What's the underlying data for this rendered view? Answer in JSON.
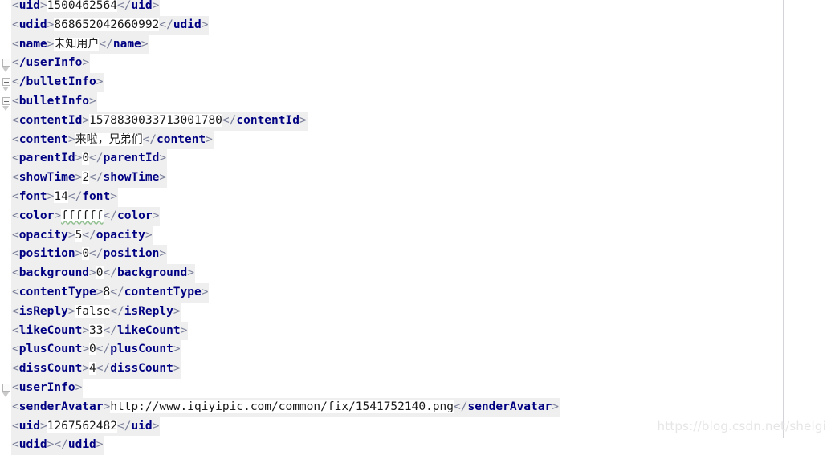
{
  "editor": {
    "type": "xml-source-view",
    "colors": {
      "tag_name": "#000082",
      "bracket": "#7a7f9a",
      "text_value": "#1a1a1a",
      "tag_highlight_bg": "#efefef",
      "background": "#ffffff",
      "fold_marker": "#b4b4b4",
      "margin_guide": "#d4d4d8",
      "spellcheck_underline": "#8fbf8f",
      "watermark": "#e6e6e6"
    },
    "margin_guide_column_x": 975
  },
  "watermark": {
    "text": "https://blog.csdn.net/shelgi"
  },
  "lines": [
    {
      "n": 1,
      "fold": "none",
      "tag": "uid",
      "value": "1500462564",
      "closing": false,
      "cjk": false,
      "typo": false
    },
    {
      "n": 2,
      "fold": "none",
      "tag": "udid",
      "value": "868652042660992",
      "closing": false,
      "cjk": false,
      "typo": false
    },
    {
      "n": 3,
      "fold": "none",
      "tag": "name",
      "value": "未知用户",
      "closing": false,
      "cjk": true,
      "typo": false
    },
    {
      "n": 4,
      "fold": "end",
      "tag": "/userInfo",
      "value": null,
      "closing": true,
      "cjk": false,
      "typo": false
    },
    {
      "n": 5,
      "fold": "end",
      "tag": "/bulletInfo",
      "value": null,
      "closing": true,
      "cjk": false,
      "typo": false
    },
    {
      "n": 6,
      "fold": "start",
      "tag": "bulletInfo",
      "value": null,
      "closing": false,
      "cjk": false,
      "typo": false
    },
    {
      "n": 7,
      "fold": "none",
      "tag": "contentId",
      "value": "1578830033713001780",
      "closing": false,
      "cjk": false,
      "typo": false
    },
    {
      "n": 8,
      "fold": "none",
      "tag": "content",
      "value": "来啦，兄弟们",
      "closing": false,
      "cjk": true,
      "typo": false
    },
    {
      "n": 9,
      "fold": "none",
      "tag": "parentId",
      "value": "0",
      "closing": false,
      "cjk": false,
      "typo": false
    },
    {
      "n": 10,
      "fold": "none",
      "tag": "showTime",
      "value": "2",
      "closing": false,
      "cjk": false,
      "typo": false
    },
    {
      "n": 11,
      "fold": "none",
      "tag": "font",
      "value": "14",
      "closing": false,
      "cjk": false,
      "typo": false
    },
    {
      "n": 12,
      "fold": "none",
      "tag": "color",
      "value": "ffffff",
      "closing": false,
      "cjk": false,
      "typo": true
    },
    {
      "n": 13,
      "fold": "none",
      "tag": "opacity",
      "value": "5",
      "closing": false,
      "cjk": false,
      "typo": false
    },
    {
      "n": 14,
      "fold": "none",
      "tag": "position",
      "value": "0",
      "closing": false,
      "cjk": false,
      "typo": false
    },
    {
      "n": 15,
      "fold": "none",
      "tag": "background",
      "value": "0",
      "closing": false,
      "cjk": false,
      "typo": false
    },
    {
      "n": 16,
      "fold": "none",
      "tag": "contentType",
      "value": "8",
      "closing": false,
      "cjk": false,
      "typo": false
    },
    {
      "n": 17,
      "fold": "none",
      "tag": "isReply",
      "value": "false",
      "closing": false,
      "cjk": false,
      "typo": false
    },
    {
      "n": 18,
      "fold": "none",
      "tag": "likeCount",
      "value": "33",
      "closing": false,
      "cjk": false,
      "typo": false
    },
    {
      "n": 19,
      "fold": "none",
      "tag": "plusCount",
      "value": "0",
      "closing": false,
      "cjk": false,
      "typo": false
    },
    {
      "n": 20,
      "fold": "none",
      "tag": "dissCount",
      "value": "4",
      "closing": false,
      "cjk": false,
      "typo": false
    },
    {
      "n": 21,
      "fold": "start",
      "tag": "userInfo",
      "value": null,
      "closing": false,
      "cjk": false,
      "typo": false
    },
    {
      "n": 22,
      "fold": "none",
      "tag": "senderAvatar",
      "value": "http://www.iqiyipic.com/common/fix/1541752140.png",
      "closing": false,
      "cjk": false,
      "typo": false
    },
    {
      "n": 23,
      "fold": "none",
      "tag": "uid",
      "value": "1267562482",
      "closing": false,
      "cjk": false,
      "typo": false
    },
    {
      "n": 24,
      "fold": "none",
      "tag": "udid",
      "value": "",
      "closing": false,
      "cjk": false,
      "typo": false
    }
  ]
}
